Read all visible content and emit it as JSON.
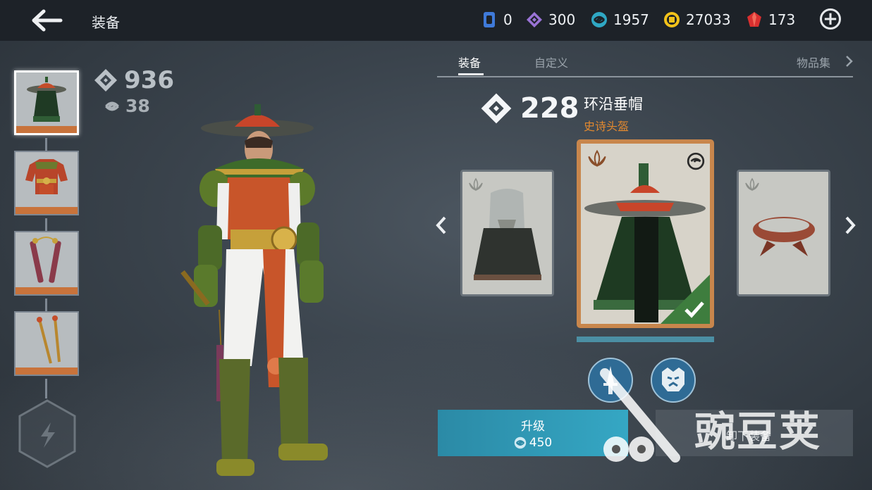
{
  "header": {
    "title": "装备",
    "currencies": [
      {
        "icon": "ticket-icon",
        "value": "0",
        "color": "#3f7ad9"
      },
      {
        "icon": "purple-diamond-icon",
        "value": "300",
        "color": "#9a73d6"
      },
      {
        "icon": "blue-swirl-icon",
        "value": "1957",
        "color": "#2fa8c4"
      },
      {
        "icon": "gold-coin-icon",
        "value": "27033",
        "color": "#f2c21a"
      },
      {
        "icon": "red-gem-icon",
        "value": "173",
        "color": "#d92f2f"
      }
    ]
  },
  "stats": {
    "power": "936",
    "level": "38"
  },
  "tabs": {
    "equip": "装备",
    "customize": "自定义",
    "collection": "物品集"
  },
  "item": {
    "power": "228",
    "name": "环沿垂帽",
    "rarity": "史诗头盔",
    "rarity_color": "#e3892f"
  },
  "actions": {
    "upgrade_label": "升级",
    "upgrade_cost": "450",
    "unequip_label": "卸下装备"
  },
  "watermark": "豌豆荚"
}
